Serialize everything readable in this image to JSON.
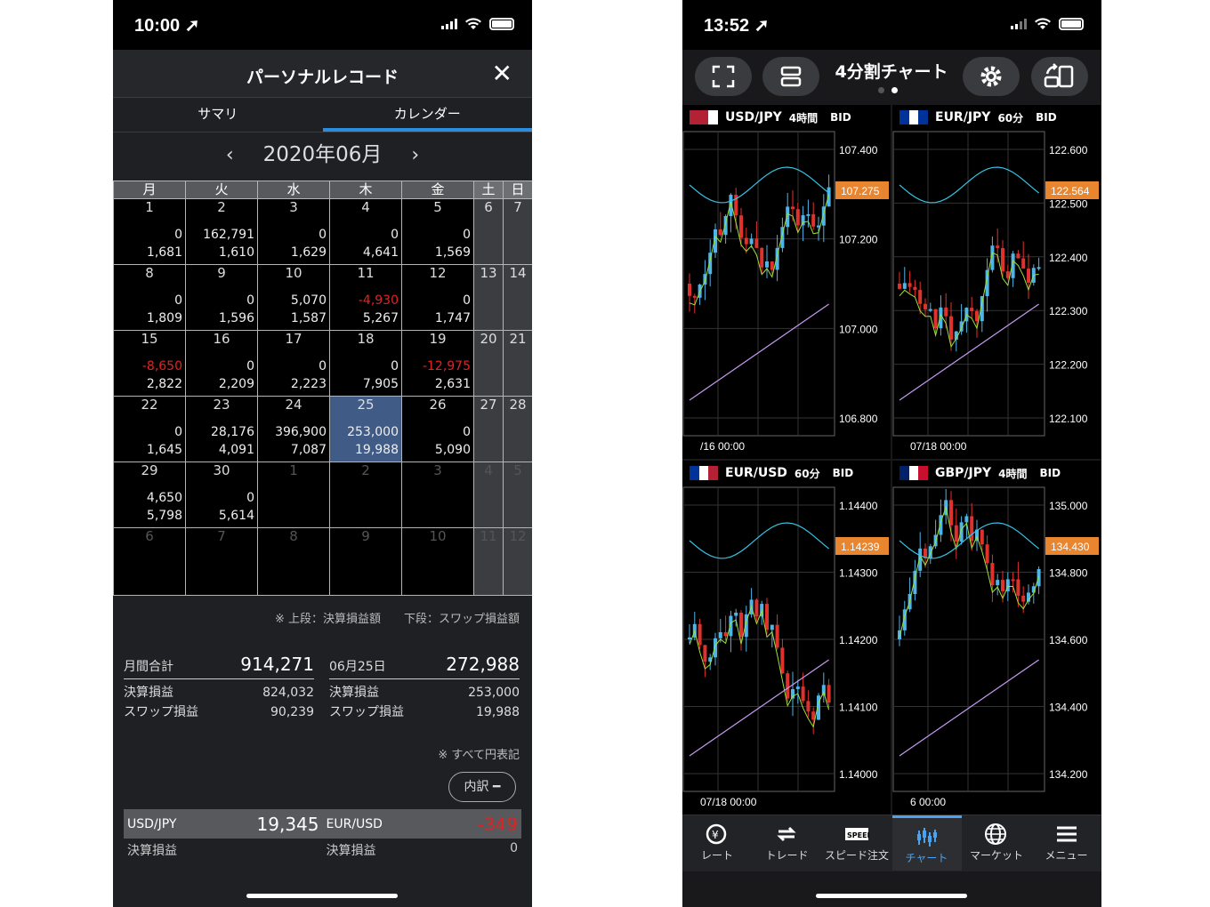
{
  "left": {
    "status": {
      "time": "10:00 ➚"
    },
    "header": {
      "title": "パーソナルレコード",
      "close": "✕"
    },
    "tabs": [
      "サマリ",
      "カレンダー"
    ],
    "month": {
      "label": "2020年06月",
      "prev": "‹",
      "next": "›"
    },
    "weekdays": [
      "月",
      "火",
      "水",
      "木",
      "金",
      "土",
      "日"
    ],
    "weeks": [
      [
        {
          "d": "1",
          "a": "0",
          "b": "1,681"
        },
        {
          "d": "2",
          "a": "162,791",
          "b": "1,610"
        },
        {
          "d": "3",
          "a": "0",
          "b": "1,629"
        },
        {
          "d": "4",
          "a": "0",
          "b": "4,641"
        },
        {
          "d": "5",
          "a": "0",
          "b": "1,569"
        },
        {
          "d": "6"
        },
        {
          "d": "7"
        }
      ],
      [
        {
          "d": "8",
          "a": "0",
          "b": "1,809"
        },
        {
          "d": "9",
          "a": "0",
          "b": "1,596"
        },
        {
          "d": "10",
          "a": "5,070",
          "b": "1,587"
        },
        {
          "d": "11",
          "a": "-4,930",
          "b": "5,267",
          "neg": true
        },
        {
          "d": "12",
          "a": "0",
          "b": "1,747"
        },
        {
          "d": "13"
        },
        {
          "d": "14"
        }
      ],
      [
        {
          "d": "15",
          "a": "-8,650",
          "b": "2,822",
          "neg": true
        },
        {
          "d": "16",
          "a": "0",
          "b": "2,209"
        },
        {
          "d": "17",
          "a": "0",
          "b": "2,223"
        },
        {
          "d": "18",
          "a": "0",
          "b": "7,905"
        },
        {
          "d": "19",
          "a": "-12,975",
          "b": "2,631",
          "neg": true
        },
        {
          "d": "20"
        },
        {
          "d": "21"
        }
      ],
      [
        {
          "d": "22",
          "a": "0",
          "b": "1,645"
        },
        {
          "d": "23",
          "a": "28,176",
          "b": "4,091"
        },
        {
          "d": "24",
          "a": "396,900",
          "b": "7,087"
        },
        {
          "d": "25",
          "a": "253,000",
          "b": "19,988",
          "sel": true
        },
        {
          "d": "26",
          "a": "0",
          "b": "5,090"
        },
        {
          "d": "27"
        },
        {
          "d": "28"
        }
      ],
      [
        {
          "d": "29",
          "a": "4,650",
          "b": "5,798"
        },
        {
          "d": "30",
          "a": "0",
          "b": "5,614"
        },
        {
          "d": "1",
          "dim": true
        },
        {
          "d": "2",
          "dim": true
        },
        {
          "d": "3",
          "dim": true
        },
        {
          "d": "4",
          "dim": true
        },
        {
          "d": "5",
          "dim": true
        }
      ],
      [
        {
          "d": "6",
          "dim": true
        },
        {
          "d": "7",
          "dim": true
        },
        {
          "d": "8",
          "dim": true
        },
        {
          "d": "9",
          "dim": true
        },
        {
          "d": "10",
          "dim": true
        },
        {
          "d": "11",
          "dim": true
        },
        {
          "d": "12",
          "dim": true
        }
      ]
    ],
    "note1": "※ 上段：決算損益額　　下段：スワップ損益額",
    "summary": {
      "month_label": "月間合計",
      "month_total": "914,271",
      "settle_label": "決算損益",
      "settle": "824,032",
      "swap_label": "スワップ損益",
      "swap": "90,239"
    },
    "day": {
      "date_label": "06月25日",
      "total": "272,988",
      "settle_label": "決算損益",
      "settle": "253,000",
      "swap_label": "スワップ損益",
      "swap": "19,988"
    },
    "note2": "※ すべて円表記",
    "breakdown_button": "内訳 ━",
    "breakdown": [
      {
        "pair": "USD/JPY",
        "value": "19,345",
        "sub_label": "決算損益",
        "sub": ""
      },
      {
        "pair": "EUR/USD",
        "value": "-349",
        "sub_label": "決算損益",
        "sub": "0"
      }
    ]
  },
  "right": {
    "status": {
      "time": "13:52 ➚"
    },
    "title": "4分割チャート",
    "panes": [
      {
        "pair": "USD/JPY",
        "tf": "4時間",
        "bid": "BID",
        "price": "107.275",
        "ticks": [
          "107.400",
          "107.200",
          "107.000",
          "106.800"
        ],
        "xlabel": "/16 00:00",
        "flag": [
          "#b22234",
          "#fff",
          "#b22234"
        ]
      },
      {
        "pair": "EUR/JPY",
        "tf": "60分",
        "bid": "BID",
        "price": "122.564",
        "ticks": [
          "122.600",
          "122.500",
          "122.400",
          "122.300",
          "122.200",
          "122.100"
        ],
        "xlabel": "07/18 00:00",
        "flag": [
          "#003399",
          "#003399",
          "#fff"
        ]
      },
      {
        "pair": "EUR/USD",
        "tf": "60分",
        "bid": "BID",
        "price": "1.14239",
        "ticks": [
          "1.14400",
          "1.14300",
          "1.14200",
          "1.14100",
          "1.14000"
        ],
        "xlabel": "07/18 00:00",
        "flag": [
          "#003399",
          "#b22234",
          "#fff"
        ]
      },
      {
        "pair": "GBP/JPY",
        "tf": "4時間",
        "bid": "BID",
        "price": "134.430",
        "ticks": [
          "135.000",
          "134.800",
          "134.600",
          "134.400",
          "134.200"
        ],
        "xlabel": "6 00:00",
        "flag": [
          "#012169",
          "#c8102e",
          "#fff"
        ]
      }
    ],
    "tabbar": [
      "レート",
      "トレード",
      "スピード注文",
      "チャート",
      "マーケット",
      "メニュー"
    ],
    "speed_badge": "SPEED"
  }
}
